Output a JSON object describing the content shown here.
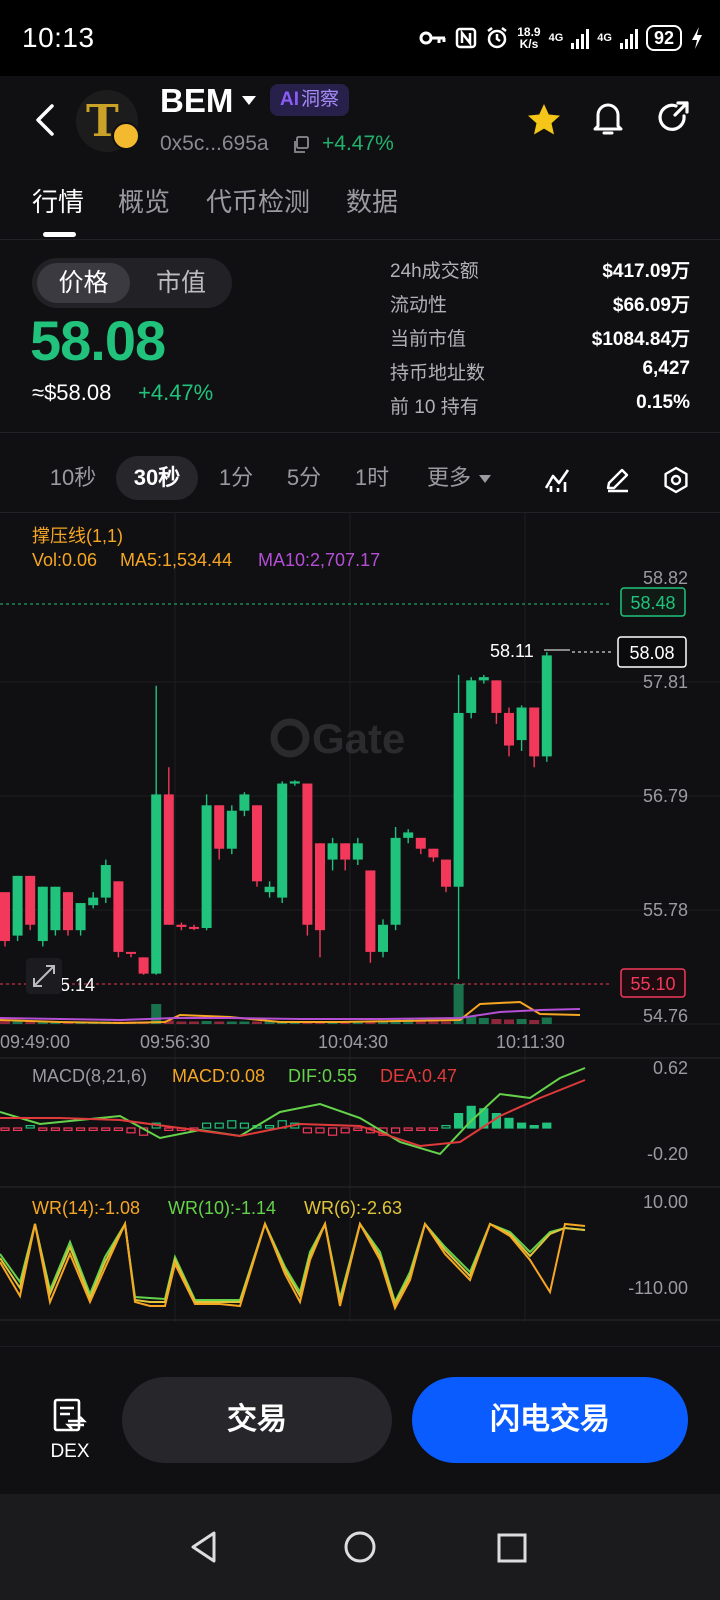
{
  "status_bar": {
    "time": "10:13",
    "net_speed_value": "18.9",
    "net_speed_unit": "K/s",
    "network1": "4G",
    "network2": "4G",
    "battery": "92"
  },
  "header": {
    "token_symbol": "BEM",
    "ai_badge_text": "洞察",
    "ai_prefix": "AI",
    "address": "0x5c...695a",
    "change": "+4.47%"
  },
  "tabs": [
    "行情",
    "概览",
    "代币检测",
    "数据"
  ],
  "price_block": {
    "seg_price": "价格",
    "seg_mcap": "市值",
    "price": "58.08",
    "usd_price": "≈$58.08",
    "usd_change": "+4.47%"
  },
  "stats": [
    {
      "label": "24h成交额",
      "value": "$417.09万"
    },
    {
      "label": "流动性",
      "value": "$66.09万"
    },
    {
      "label": "当前市值",
      "value": "$1084.84万"
    },
    {
      "label": "持币地址数",
      "value": "6,427"
    },
    {
      "label": "前 10 持有",
      "value": "0.15%"
    }
  ],
  "intervals": [
    "10秒",
    "30秒",
    "1分",
    "5分",
    "1时",
    "更多"
  ],
  "chart_labels": {
    "overlay_name": "撑压线(1,1)",
    "vol": "Vol:0.06",
    "ma5": "MA5:1,534.44",
    "ma10": "MA10:2,707.17",
    "watermark": "Gate",
    "price_axis": [
      "58.82",
      "57.81",
      "56.79",
      "55.78",
      "54.76"
    ],
    "resistance_tag": "58.48",
    "current_tag": "58.08",
    "support_tag": "55.10",
    "high_label": "58.11",
    "low_label": "55.14",
    "time_axis": [
      "09:49:00",
      "09:56:30",
      "10:04:30",
      "10:11:30"
    ],
    "macd_name": "MACD(8,21,6)",
    "macd_val": "MACD:0.08",
    "dif_val": "DIF:0.55",
    "dea_val": "DEA:0.47",
    "macd_axis_top": "0.62",
    "macd_axis_bottom": "-0.20",
    "wr14": "WR(14):-1.08",
    "wr10": "WR(10):-1.14",
    "wr6": "WR(6):-2.63",
    "wr_axis_top": "10.00",
    "wr_axis_bottom": "-110.00"
  },
  "colors": {
    "up": "#20c27c",
    "down": "#f2395b",
    "ma5": "#f5a623",
    "ma10": "#b44fd6",
    "accent_blue": "#0a5cff"
  },
  "bottom": {
    "dex_label": "DEX",
    "trade": "交易",
    "flash_trade": "闪电交易"
  },
  "chart_data": {
    "type": "candlestick",
    "y_range": [
      54.76,
      58.82
    ],
    "candles": [
      {
        "o": 55.9,
        "c": 55.45,
        "h": 55.9,
        "l": 55.4
      },
      {
        "o": 55.5,
        "c": 56.05,
        "h": 56.05,
        "l": 55.45
      },
      {
        "o": 56.05,
        "c": 55.6,
        "h": 56.05,
        "l": 55.55
      },
      {
        "o": 55.45,
        "c": 55.95,
        "h": 55.95,
        "l": 55.4
      },
      {
        "o": 55.55,
        "c": 55.95,
        "h": 55.95,
        "l": 55.5
      },
      {
        "o": 55.9,
        "c": 55.55,
        "h": 55.9,
        "l": 55.5
      },
      {
        "o": 55.55,
        "c": 55.8,
        "h": 55.8,
        "l": 55.5
      },
      {
        "o": 55.78,
        "c": 55.85,
        "h": 55.9,
        "l": 55.75
      },
      {
        "o": 55.85,
        "c": 56.15,
        "h": 56.2,
        "l": 55.8
      },
      {
        "o": 56.0,
        "c": 55.35,
        "h": 56.0,
        "l": 55.3
      },
      {
        "o": 55.35,
        "c": 55.34,
        "h": 55.35,
        "l": 55.3
      },
      {
        "o": 55.3,
        "c": 55.15,
        "h": 55.3,
        "l": 55.14
      },
      {
        "o": 55.15,
        "c": 56.8,
        "h": 57.8,
        "l": 55.14
      },
      {
        "o": 56.8,
        "c": 55.6,
        "h": 57.05,
        "l": 55.6
      },
      {
        "o": 55.6,
        "c": 55.58,
        "h": 55.62,
        "l": 55.55
      },
      {
        "o": 55.58,
        "c": 55.57,
        "h": 55.6,
        "l": 55.55
      },
      {
        "o": 55.57,
        "c": 56.7,
        "h": 56.8,
        "l": 55.55
      },
      {
        "o": 56.7,
        "c": 56.3,
        "h": 56.7,
        "l": 56.2
      },
      {
        "o": 56.3,
        "c": 56.65,
        "h": 56.7,
        "l": 56.25
      },
      {
        "o": 56.65,
        "c": 56.8,
        "h": 56.82,
        "l": 56.6
      },
      {
        "o": 56.7,
        "c": 56.0,
        "h": 56.7,
        "l": 55.95
      },
      {
        "o": 55.9,
        "c": 55.95,
        "h": 56.0,
        "l": 55.85
      },
      {
        "o": 55.85,
        "c": 56.9,
        "h": 56.92,
        "l": 55.8
      },
      {
        "o": 56.9,
        "c": 56.92,
        "h": 56.93,
        "l": 56.88
      },
      {
        "o": 56.9,
        "c": 55.6,
        "h": 56.9,
        "l": 55.5
      },
      {
        "o": 56.35,
        "c": 55.55,
        "h": 56.35,
        "l": 55.3
      },
      {
        "o": 56.2,
        "c": 56.35,
        "h": 56.4,
        "l": 56.1
      },
      {
        "o": 56.35,
        "c": 56.2,
        "h": 56.35,
        "l": 56.1
      },
      {
        "o": 56.2,
        "c": 56.35,
        "h": 56.4,
        "l": 56.15
      },
      {
        "o": 56.1,
        "c": 55.35,
        "h": 56.1,
        "l": 55.25
      },
      {
        "o": 55.35,
        "c": 55.6,
        "h": 55.65,
        "l": 55.3
      },
      {
        "o": 55.6,
        "c": 56.4,
        "h": 56.5,
        "l": 55.55
      },
      {
        "o": 56.4,
        "c": 56.45,
        "h": 56.48,
        "l": 56.35
      },
      {
        "o": 56.4,
        "c": 56.3,
        "h": 56.4,
        "l": 56.25
      },
      {
        "o": 56.3,
        "c": 56.22,
        "h": 56.3,
        "l": 56.18
      },
      {
        "o": 56.2,
        "c": 55.95,
        "h": 56.2,
        "l": 55.9
      },
      {
        "o": 55.95,
        "c": 57.55,
        "h": 57.9,
        "l": 55.1
      },
      {
        "o": 57.55,
        "c": 57.85,
        "h": 57.88,
        "l": 57.5
      },
      {
        "o": 57.85,
        "c": 57.88,
        "h": 57.9,
        "l": 57.82
      },
      {
        "o": 57.85,
        "c": 57.55,
        "h": 57.85,
        "l": 57.45
      },
      {
        "o": 57.55,
        "c": 57.25,
        "h": 57.6,
        "l": 57.15
      },
      {
        "o": 57.3,
        "c": 57.6,
        "h": 57.62,
        "l": 57.2
      },
      {
        "o": 57.6,
        "c": 57.15,
        "h": 57.6,
        "l": 57.05
      },
      {
        "o": 57.15,
        "c": 58.08,
        "h": 58.11,
        "l": 57.1
      }
    ]
  }
}
